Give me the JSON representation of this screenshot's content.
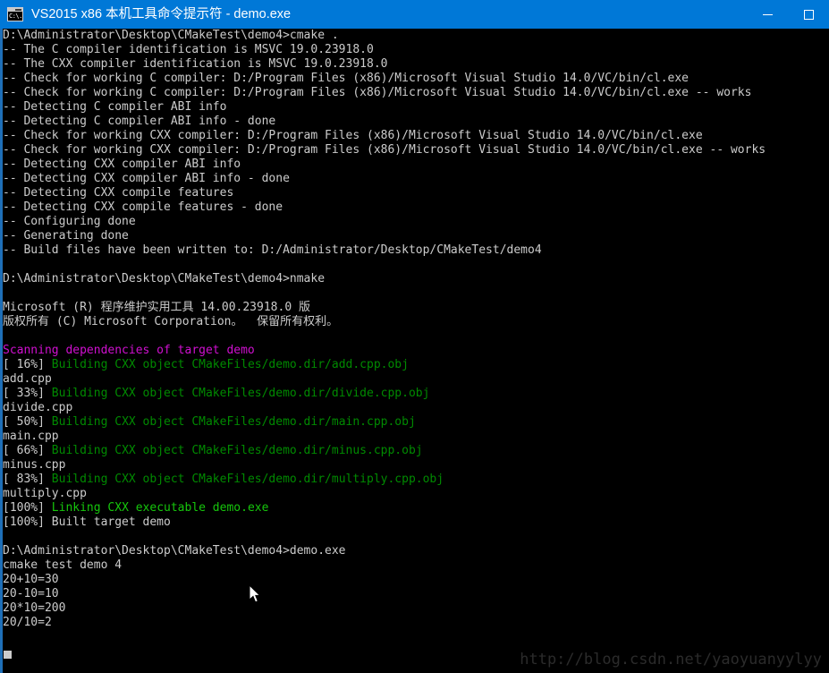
{
  "window": {
    "title": "VS2015 x86 本机工具命令提示符 - demo.exe",
    "icon": "console-icon",
    "icon_glyph": "C:\\.",
    "titlebar_color": "#0078d7",
    "background_color": "#000000"
  },
  "window_controls": {
    "minimize_label": "",
    "maximize_label": ""
  },
  "colors": {
    "text_default": "#cccccc",
    "green": "#008a00",
    "bright_green": "#16c60c",
    "magenta": "#d010d0",
    "accent": "#0078d7",
    "left_border": "#1e6fb8",
    "watermark": "#2b2b2b"
  },
  "console": {
    "prompt_path": "D:\\Administrator\\Desktop\\CMakeTest\\demo4",
    "lines": [
      {
        "segments": [
          {
            "text": "D:\\Administrator\\Desktop\\CMakeTest\\demo4>cmake .",
            "color": "white"
          }
        ]
      },
      {
        "segments": [
          {
            "text": "-- The C compiler identification is MSVC 19.0.23918.0",
            "color": "white"
          }
        ]
      },
      {
        "segments": [
          {
            "text": "-- The CXX compiler identification is MSVC 19.0.23918.0",
            "color": "white"
          }
        ]
      },
      {
        "segments": [
          {
            "text": "-- Check for working C compiler: D:/Program Files (x86)/Microsoft Visual Studio 14.0/VC/bin/cl.exe",
            "color": "white"
          }
        ]
      },
      {
        "segments": [
          {
            "text": "-- Check for working C compiler: D:/Program Files (x86)/Microsoft Visual Studio 14.0/VC/bin/cl.exe -- works",
            "color": "white"
          }
        ]
      },
      {
        "segments": [
          {
            "text": "-- Detecting C compiler ABI info",
            "color": "white"
          }
        ]
      },
      {
        "segments": [
          {
            "text": "-- Detecting C compiler ABI info - done",
            "color": "white"
          }
        ]
      },
      {
        "segments": [
          {
            "text": "-- Check for working CXX compiler: D:/Program Files (x86)/Microsoft Visual Studio 14.0/VC/bin/cl.exe",
            "color": "white"
          }
        ]
      },
      {
        "segments": [
          {
            "text": "-- Check for working CXX compiler: D:/Program Files (x86)/Microsoft Visual Studio 14.0/VC/bin/cl.exe -- works",
            "color": "white"
          }
        ]
      },
      {
        "segments": [
          {
            "text": "-- Detecting CXX compiler ABI info",
            "color": "white"
          }
        ]
      },
      {
        "segments": [
          {
            "text": "-- Detecting CXX compiler ABI info - done",
            "color": "white"
          }
        ]
      },
      {
        "segments": [
          {
            "text": "-- Detecting CXX compile features",
            "color": "white"
          }
        ]
      },
      {
        "segments": [
          {
            "text": "-- Detecting CXX compile features - done",
            "color": "white"
          }
        ]
      },
      {
        "segments": [
          {
            "text": "-- Configuring done",
            "color": "white"
          }
        ]
      },
      {
        "segments": [
          {
            "text": "-- Generating done",
            "color": "white"
          }
        ]
      },
      {
        "segments": [
          {
            "text": "-- Build files have been written to: D:/Administrator/Desktop/CMakeTest/demo4",
            "color": "white"
          }
        ]
      },
      {
        "segments": [
          {
            "text": "",
            "color": "white"
          }
        ]
      },
      {
        "segments": [
          {
            "text": "D:\\Administrator\\Desktop\\CMakeTest\\demo4>nmake",
            "color": "white"
          }
        ]
      },
      {
        "segments": [
          {
            "text": "",
            "color": "white"
          }
        ]
      },
      {
        "segments": [
          {
            "text": "Microsoft (R) 程序维护实用工具 14.00.23918.0 版",
            "color": "white"
          }
        ]
      },
      {
        "segments": [
          {
            "text": "版权所有 (C) Microsoft Corporation。  保留所有权利。",
            "color": "white"
          }
        ]
      },
      {
        "segments": [
          {
            "text": "",
            "color": "white"
          }
        ]
      },
      {
        "segments": [
          {
            "text": "Scanning dependencies of target demo",
            "color": "magenta"
          }
        ]
      },
      {
        "segments": [
          {
            "text": "[ 16%] ",
            "color": "white"
          },
          {
            "text": "Building CXX object CMakeFiles/demo.dir/add.cpp.obj",
            "color": "green"
          }
        ]
      },
      {
        "segments": [
          {
            "text": "add.cpp",
            "color": "white"
          }
        ]
      },
      {
        "segments": [
          {
            "text": "[ 33%] ",
            "color": "white"
          },
          {
            "text": "Building CXX object CMakeFiles/demo.dir/divide.cpp.obj",
            "color": "green"
          }
        ]
      },
      {
        "segments": [
          {
            "text": "divide.cpp",
            "color": "white"
          }
        ]
      },
      {
        "segments": [
          {
            "text": "[ 50%] ",
            "color": "white"
          },
          {
            "text": "Building CXX object CMakeFiles/demo.dir/main.cpp.obj",
            "color": "green"
          }
        ]
      },
      {
        "segments": [
          {
            "text": "main.cpp",
            "color": "white"
          }
        ]
      },
      {
        "segments": [
          {
            "text": "[ 66%] ",
            "color": "white"
          },
          {
            "text": "Building CXX object CMakeFiles/demo.dir/minus.cpp.obj",
            "color": "green"
          }
        ]
      },
      {
        "segments": [
          {
            "text": "minus.cpp",
            "color": "white"
          }
        ]
      },
      {
        "segments": [
          {
            "text": "[ 83%] ",
            "color": "white"
          },
          {
            "text": "Building CXX object CMakeFiles/demo.dir/multiply.cpp.obj",
            "color": "green"
          }
        ]
      },
      {
        "segments": [
          {
            "text": "multiply.cpp",
            "color": "white"
          }
        ]
      },
      {
        "segments": [
          {
            "text": "[100%] ",
            "color": "white"
          },
          {
            "text": "Linking CXX executable demo.exe",
            "color": "bgreen"
          }
        ]
      },
      {
        "segments": [
          {
            "text": "[100%] Built target demo",
            "color": "white"
          }
        ]
      },
      {
        "segments": [
          {
            "text": "",
            "color": "white"
          }
        ]
      },
      {
        "segments": [
          {
            "text": "D:\\Administrator\\Desktop\\CMakeTest\\demo4>demo.exe",
            "color": "white"
          }
        ]
      },
      {
        "segments": [
          {
            "text": "cmake test demo 4",
            "color": "white"
          }
        ]
      },
      {
        "segments": [
          {
            "text": "20+10=30",
            "color": "white"
          }
        ]
      },
      {
        "segments": [
          {
            "text": "20-10=10",
            "color": "white"
          }
        ]
      },
      {
        "segments": [
          {
            "text": "20*10=200",
            "color": "white"
          }
        ]
      },
      {
        "segments": [
          {
            "text": "20/10=2",
            "color": "white"
          }
        ]
      }
    ]
  },
  "watermark": {
    "text": "http://blog.csdn.net/yaoyuanyylyy"
  }
}
